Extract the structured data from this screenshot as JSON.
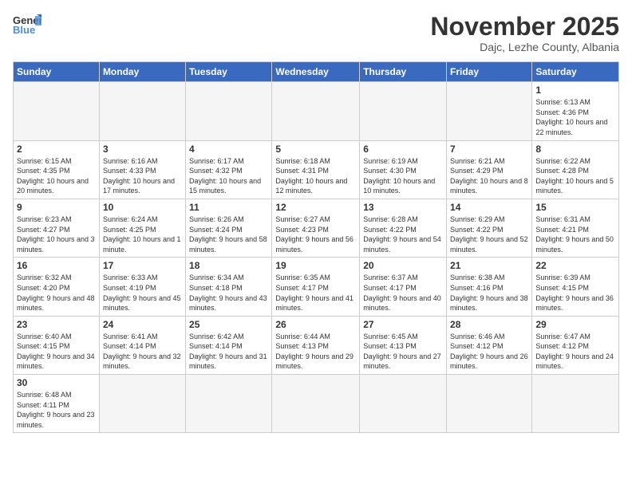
{
  "header": {
    "logo_general": "General",
    "logo_blue": "Blue",
    "title": "November 2025",
    "location": "Dajc, Lezhe County, Albania"
  },
  "days_of_week": [
    "Sunday",
    "Monday",
    "Tuesday",
    "Wednesday",
    "Thursday",
    "Friday",
    "Saturday"
  ],
  "weeks": [
    [
      {
        "day": "",
        "info": "",
        "empty": true
      },
      {
        "day": "",
        "info": "",
        "empty": true
      },
      {
        "day": "",
        "info": "",
        "empty": true
      },
      {
        "day": "",
        "info": "",
        "empty": true
      },
      {
        "day": "",
        "info": "",
        "empty": true
      },
      {
        "day": "",
        "info": "",
        "empty": true
      },
      {
        "day": "1",
        "info": "Sunrise: 6:13 AM\nSunset: 4:36 PM\nDaylight: 10 hours\nand 22 minutes."
      }
    ],
    [
      {
        "day": "2",
        "info": "Sunrise: 6:15 AM\nSunset: 4:35 PM\nDaylight: 10 hours\nand 20 minutes."
      },
      {
        "day": "3",
        "info": "Sunrise: 6:16 AM\nSunset: 4:33 PM\nDaylight: 10 hours\nand 17 minutes."
      },
      {
        "day": "4",
        "info": "Sunrise: 6:17 AM\nSunset: 4:32 PM\nDaylight: 10 hours\nand 15 minutes."
      },
      {
        "day": "5",
        "info": "Sunrise: 6:18 AM\nSunset: 4:31 PM\nDaylight: 10 hours\nand 12 minutes."
      },
      {
        "day": "6",
        "info": "Sunrise: 6:19 AM\nSunset: 4:30 PM\nDaylight: 10 hours\nand 10 minutes."
      },
      {
        "day": "7",
        "info": "Sunrise: 6:21 AM\nSunset: 4:29 PM\nDaylight: 10 hours\nand 8 minutes."
      },
      {
        "day": "8",
        "info": "Sunrise: 6:22 AM\nSunset: 4:28 PM\nDaylight: 10 hours\nand 5 minutes."
      }
    ],
    [
      {
        "day": "9",
        "info": "Sunrise: 6:23 AM\nSunset: 4:27 PM\nDaylight: 10 hours\nand 3 minutes."
      },
      {
        "day": "10",
        "info": "Sunrise: 6:24 AM\nSunset: 4:25 PM\nDaylight: 10 hours\nand 1 minute."
      },
      {
        "day": "11",
        "info": "Sunrise: 6:26 AM\nSunset: 4:24 PM\nDaylight: 9 hours\nand 58 minutes."
      },
      {
        "day": "12",
        "info": "Sunrise: 6:27 AM\nSunset: 4:23 PM\nDaylight: 9 hours\nand 56 minutes."
      },
      {
        "day": "13",
        "info": "Sunrise: 6:28 AM\nSunset: 4:22 PM\nDaylight: 9 hours\nand 54 minutes."
      },
      {
        "day": "14",
        "info": "Sunrise: 6:29 AM\nSunset: 4:22 PM\nDaylight: 9 hours\nand 52 minutes."
      },
      {
        "day": "15",
        "info": "Sunrise: 6:31 AM\nSunset: 4:21 PM\nDaylight: 9 hours\nand 50 minutes."
      }
    ],
    [
      {
        "day": "16",
        "info": "Sunrise: 6:32 AM\nSunset: 4:20 PM\nDaylight: 9 hours\nand 48 minutes."
      },
      {
        "day": "17",
        "info": "Sunrise: 6:33 AM\nSunset: 4:19 PM\nDaylight: 9 hours\nand 45 minutes."
      },
      {
        "day": "18",
        "info": "Sunrise: 6:34 AM\nSunset: 4:18 PM\nDaylight: 9 hours\nand 43 minutes."
      },
      {
        "day": "19",
        "info": "Sunrise: 6:35 AM\nSunset: 4:17 PM\nDaylight: 9 hours\nand 41 minutes."
      },
      {
        "day": "20",
        "info": "Sunrise: 6:37 AM\nSunset: 4:17 PM\nDaylight: 9 hours\nand 40 minutes."
      },
      {
        "day": "21",
        "info": "Sunrise: 6:38 AM\nSunset: 4:16 PM\nDaylight: 9 hours\nand 38 minutes."
      },
      {
        "day": "22",
        "info": "Sunrise: 6:39 AM\nSunset: 4:15 PM\nDaylight: 9 hours\nand 36 minutes."
      }
    ],
    [
      {
        "day": "23",
        "info": "Sunrise: 6:40 AM\nSunset: 4:15 PM\nDaylight: 9 hours\nand 34 minutes."
      },
      {
        "day": "24",
        "info": "Sunrise: 6:41 AM\nSunset: 4:14 PM\nDaylight: 9 hours\nand 32 minutes."
      },
      {
        "day": "25",
        "info": "Sunrise: 6:42 AM\nSunset: 4:14 PM\nDaylight: 9 hours\nand 31 minutes."
      },
      {
        "day": "26",
        "info": "Sunrise: 6:44 AM\nSunset: 4:13 PM\nDaylight: 9 hours\nand 29 minutes."
      },
      {
        "day": "27",
        "info": "Sunrise: 6:45 AM\nSunset: 4:13 PM\nDaylight: 9 hours\nand 27 minutes."
      },
      {
        "day": "28",
        "info": "Sunrise: 6:46 AM\nSunset: 4:12 PM\nDaylight: 9 hours\nand 26 minutes."
      },
      {
        "day": "29",
        "info": "Sunrise: 6:47 AM\nSunset: 4:12 PM\nDaylight: 9 hours\nand 24 minutes."
      }
    ],
    [
      {
        "day": "30",
        "info": "Sunrise: 6:48 AM\nSunset: 4:11 PM\nDaylight: 9 hours\nand 23 minutes.",
        "last": true
      },
      {
        "day": "",
        "info": "",
        "empty": true,
        "last": true
      },
      {
        "day": "",
        "info": "",
        "empty": true,
        "last": true
      },
      {
        "day": "",
        "info": "",
        "empty": true,
        "last": true
      },
      {
        "day": "",
        "info": "",
        "empty": true,
        "last": true
      },
      {
        "day": "",
        "info": "",
        "empty": true,
        "last": true
      },
      {
        "day": "",
        "info": "",
        "empty": true,
        "last": true
      }
    ]
  ]
}
